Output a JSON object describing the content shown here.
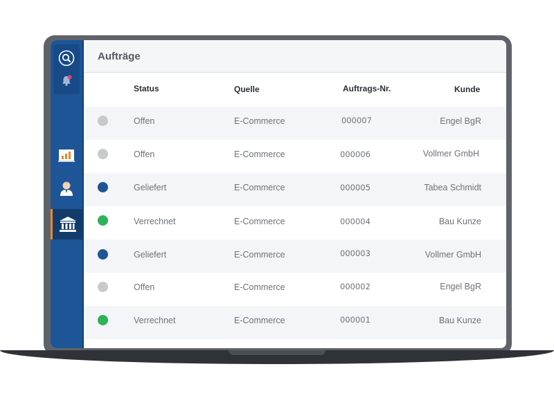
{
  "header": {
    "title": "Aufträge"
  },
  "sidebar": {
    "items": [
      {
        "name": "search",
        "icon": "search-icon"
      },
      {
        "name": "notifications",
        "icon": "bell-icon",
        "badge": ""
      },
      {
        "name": "reports",
        "icon": "bar-chart-icon"
      },
      {
        "name": "customers",
        "icon": "person-icon"
      },
      {
        "name": "bank",
        "icon": "bank-icon",
        "active": true
      }
    ]
  },
  "table": {
    "columns": [
      "Status",
      "Quelle",
      "Auftrags-Nr.",
      "Kunde"
    ],
    "rows": [
      {
        "status": "Offen",
        "status_color": "#c8c9cb",
        "source": "E-Commerce",
        "number": "000007",
        "customer": "Engel BgR"
      },
      {
        "status": "Offen",
        "status_color": "#c8c9cb",
        "source": "E-Commerce",
        "number": "000006",
        "customer": "Vollmer GmbH"
      },
      {
        "status": "Geliefert",
        "status_color": "#1d5597",
        "source": "E-Commerce",
        "number": "000005",
        "customer": "Tabea Schmidt"
      },
      {
        "status": "Verrechnet",
        "status_color": "#2eb25a",
        "source": "E-Commerce",
        "number": "000004",
        "customer": "Bau Kunze"
      },
      {
        "status": "Geliefert",
        "status_color": "#1d5597",
        "source": "E-Commerce",
        "number": "000003",
        "customer": "Vollmer GmbH"
      },
      {
        "status": "Offen",
        "status_color": "#c8c9cb",
        "source": "E-Commerce",
        "number": "000002",
        "customer": "Engel BgR"
      },
      {
        "status": "Verrechnet",
        "status_color": "#2eb25a",
        "source": "E-Commerce",
        "number": "000001",
        "customer": "Bau Kunze"
      }
    ]
  },
  "colors": {
    "sidebar": "#1d5597",
    "accent": "#e98a2c",
    "delivered": "#1d5597",
    "billed": "#2eb25a",
    "open": "#c8c9cb"
  }
}
